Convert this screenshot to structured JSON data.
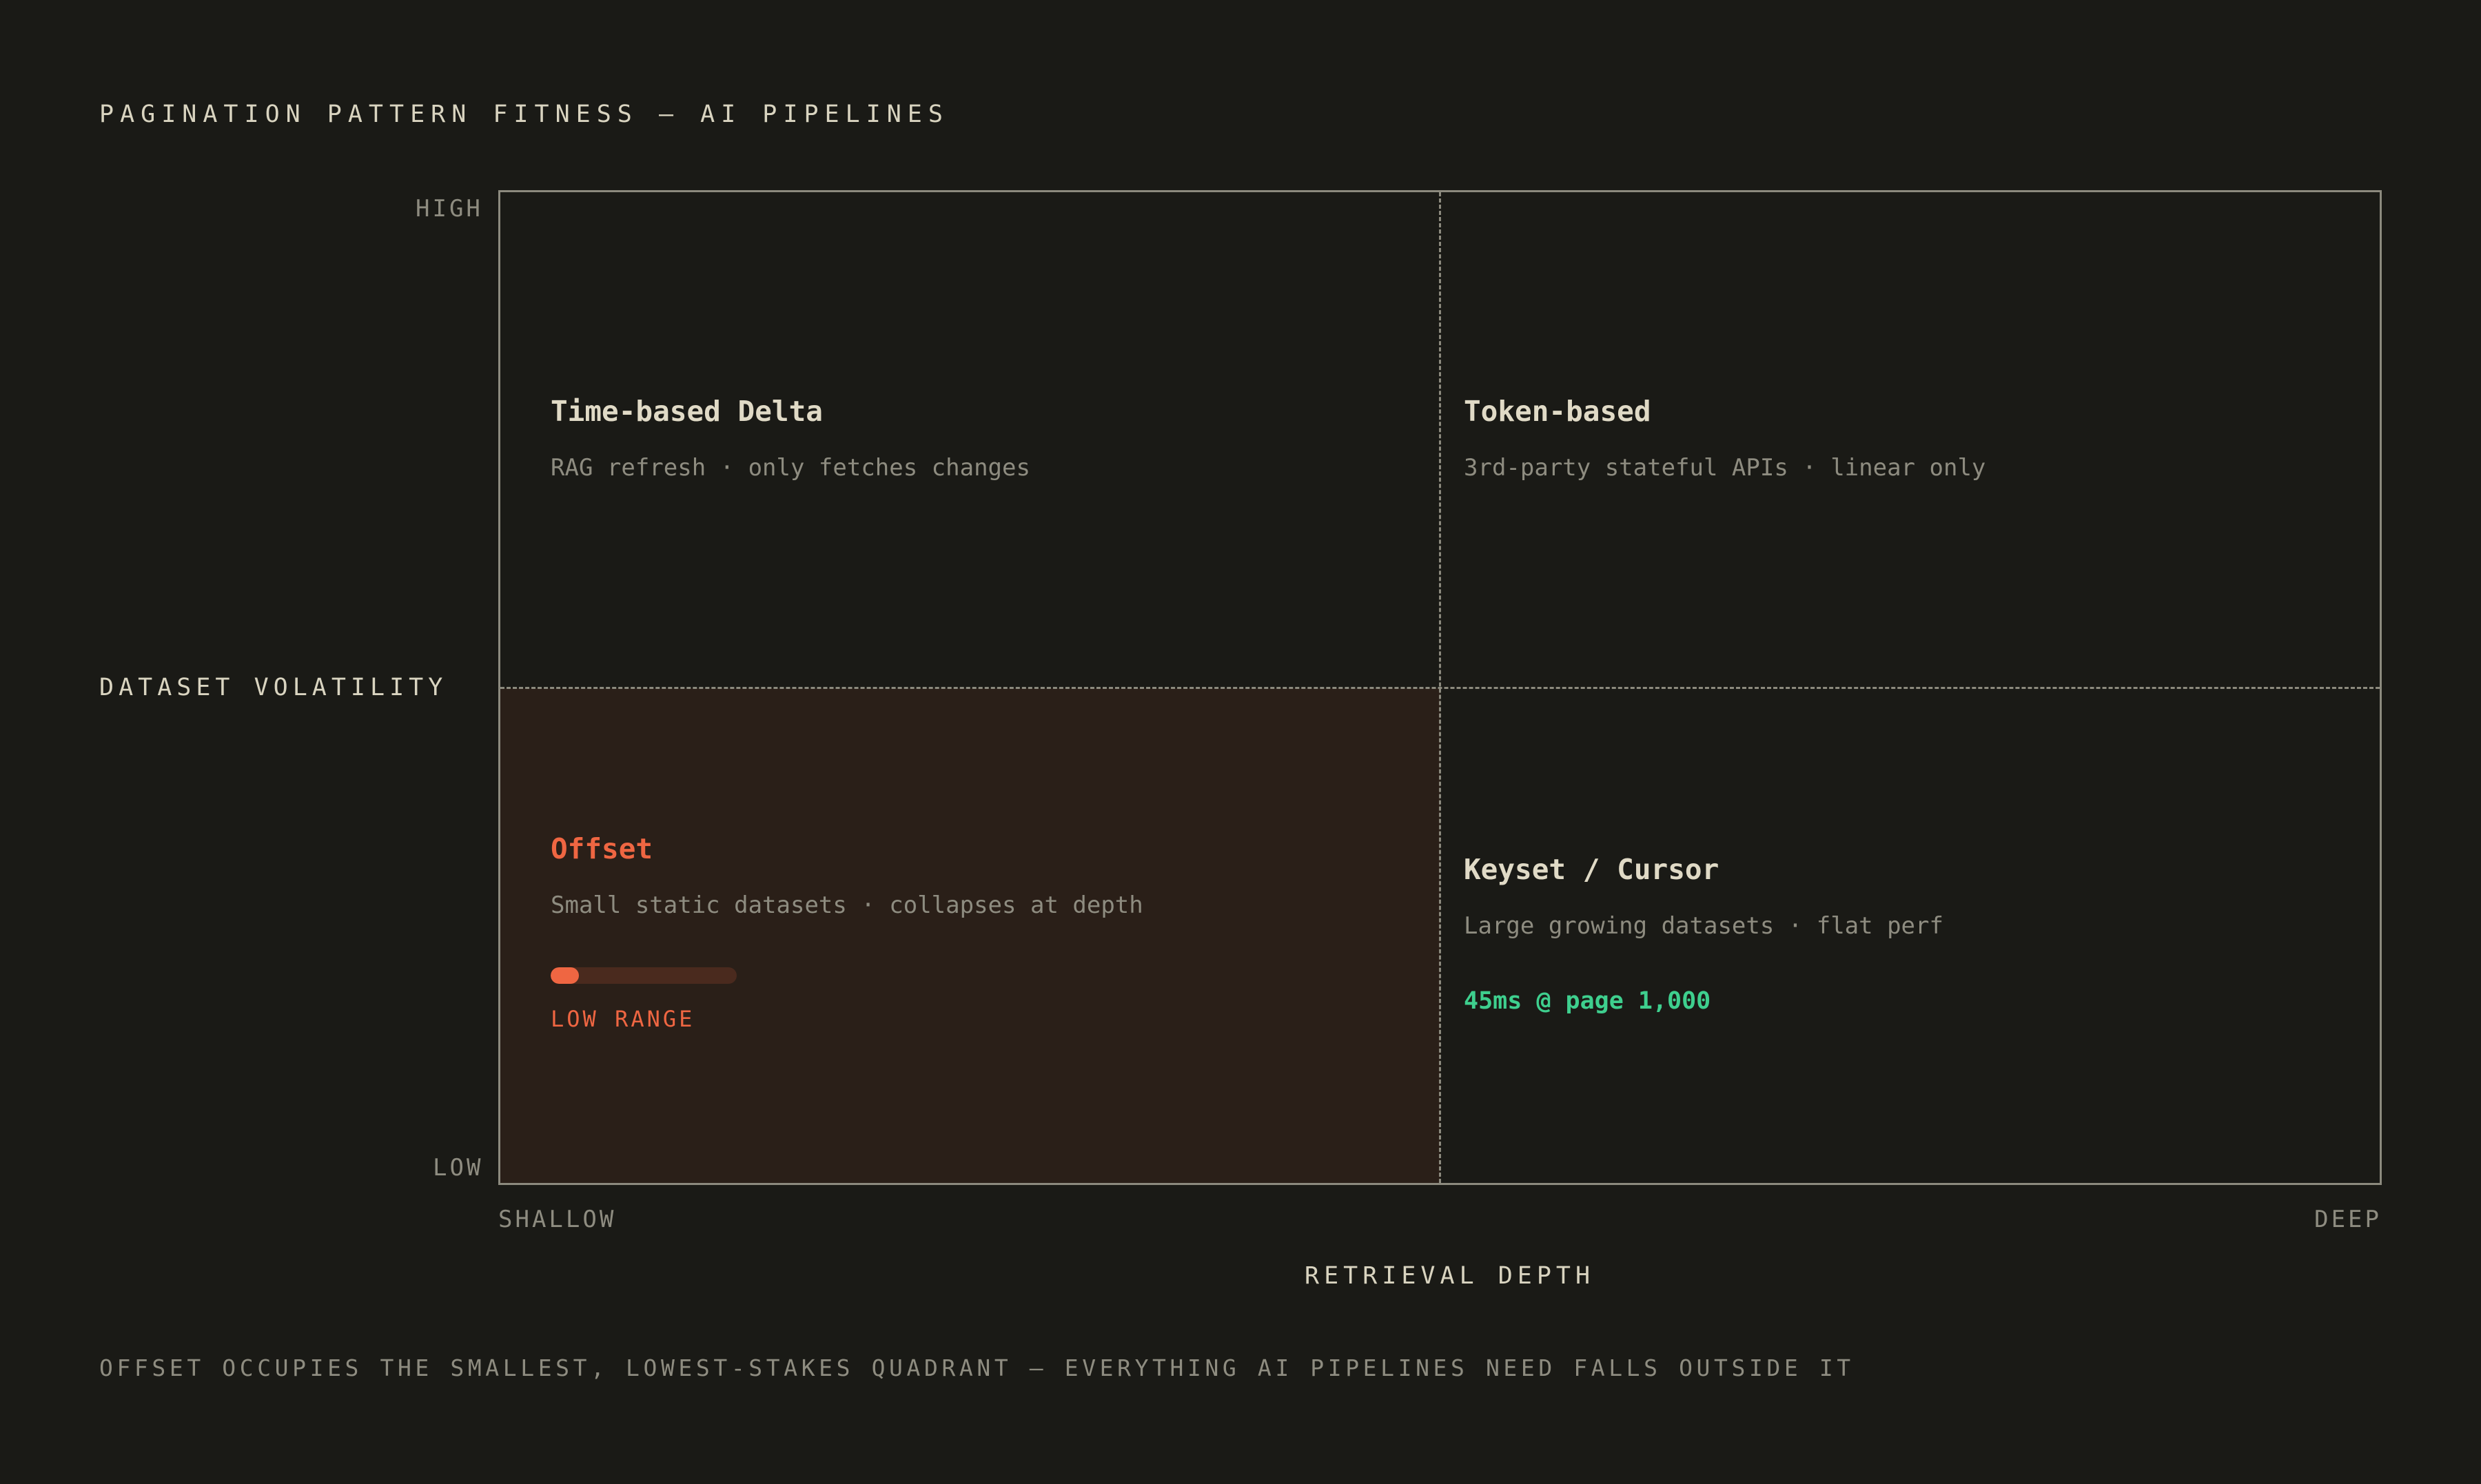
{
  "title": "PAGINATION PATTERN FITNESS — AI PIPELINES",
  "y_axis": {
    "name": "DATASET VOLATILITY",
    "high": "HIGH",
    "low": "LOW"
  },
  "x_axis": {
    "name": "RETRIEVAL DEPTH",
    "low": "SHALLOW",
    "high": "DEEP"
  },
  "quadrants": {
    "top_left": {
      "title": "Time-based Delta",
      "description": "RAG refresh · only fetches changes"
    },
    "top_right": {
      "title": "Token-based",
      "description": "3rd-party stateful APIs · linear only"
    },
    "bottom_left": {
      "title": "Offset",
      "description": "Small static datasets · collapses at depth",
      "range_label": "LOW RANGE",
      "range_fraction": 0.15,
      "highlighted": true
    },
    "bottom_right": {
      "title": "Keyset / Cursor",
      "description": "Large growing datasets · flat perf",
      "metric": "45ms @ page 1,000"
    }
  },
  "footnote": "OFFSET OCCUPIES THE SMALLEST, LOWEST-STAKES QUADRANT — EVERYTHING AI PIPELINES NEED FALLS OUTSIDE IT",
  "colors": {
    "background": "#1a1a16",
    "highlight_cell": "#2a1f18",
    "accent": "#ef6642",
    "metric": "#3ecf8e",
    "text": "#e0dac6",
    "muted": "#8e8c80",
    "border": "#8c8a7e"
  }
}
